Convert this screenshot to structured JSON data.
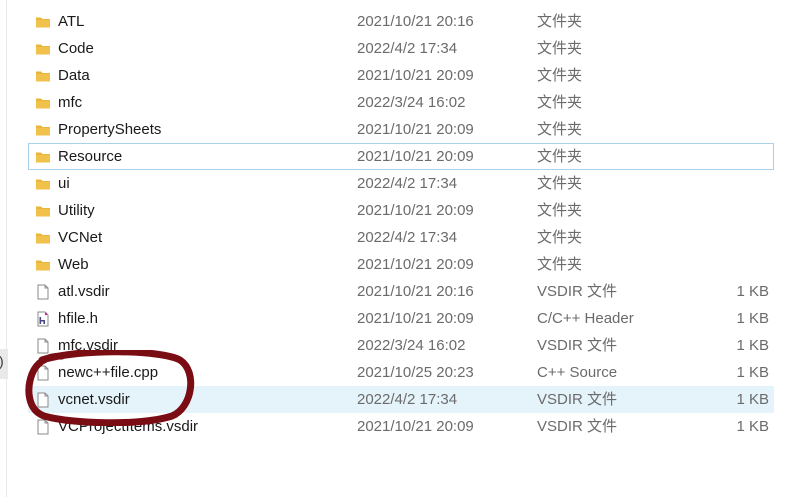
{
  "files": [
    {
      "name": "ATL",
      "date": "2021/10/21 20:16",
      "type": "文件夹",
      "size": "",
      "icon": "folder-icon"
    },
    {
      "name": "Code",
      "date": "2022/4/2 17:34",
      "type": "文件夹",
      "size": "",
      "icon": "folder-icon"
    },
    {
      "name": "Data",
      "date": "2021/10/21 20:09",
      "type": "文件夹",
      "size": "",
      "icon": "folder-icon"
    },
    {
      "name": "mfc",
      "date": "2022/3/24 16:02",
      "type": "文件夹",
      "size": "",
      "icon": "folder-icon"
    },
    {
      "name": "PropertySheets",
      "date": "2021/10/21 20:09",
      "type": "文件夹",
      "size": "",
      "icon": "folder-icon"
    },
    {
      "name": "Resource",
      "date": "2021/10/21 20:09",
      "type": "文件夹",
      "size": "",
      "icon": "folder-icon",
      "state": "focused"
    },
    {
      "name": "ui",
      "date": "2022/4/2 17:34",
      "type": "文件夹",
      "size": "",
      "icon": "folder-icon"
    },
    {
      "name": "Utility",
      "date": "2021/10/21 20:09",
      "type": "文件夹",
      "size": "",
      "icon": "folder-icon"
    },
    {
      "name": "VCNet",
      "date": "2022/4/2 17:34",
      "type": "文件夹",
      "size": "",
      "icon": "folder-icon"
    },
    {
      "name": "Web",
      "date": "2021/10/21 20:09",
      "type": "文件夹",
      "size": "",
      "icon": "folder-icon"
    },
    {
      "name": "atl.vsdir",
      "date": "2021/10/21 20:16",
      "type": "VSDIR 文件",
      "size": "1 KB",
      "icon": "document-icon"
    },
    {
      "name": "hfile.h",
      "date": "2021/10/21 20:09",
      "type": "C/C++ Header",
      "size": "1 KB",
      "icon": "header-file-icon"
    },
    {
      "name": "mfc.vsdir",
      "date": "2022/3/24 16:02",
      "type": "VSDIR 文件",
      "size": "1 KB",
      "icon": "document-icon"
    },
    {
      "name": "newc++file.cpp",
      "date": "2021/10/25 20:23",
      "type": "C++ Source",
      "size": "1 KB",
      "icon": "document-icon"
    },
    {
      "name": "vcnet.vsdir",
      "date": "2022/4/2 17:34",
      "type": "VSDIR 文件",
      "size": "1 KB",
      "icon": "document-icon",
      "state": "selected"
    },
    {
      "name": "VCProjectItems.vsdir",
      "date": "2021/10/21 20:09",
      "type": "VSDIR 文件",
      "size": "1 KB",
      "icon": "document-icon"
    }
  ],
  "edge_glyph": ")",
  "colors": {
    "folder": "#f0c24b",
    "selected_bg": "#e5f3fb",
    "focus_border": "#a9d1e8",
    "annotation": "#7a0d14"
  }
}
